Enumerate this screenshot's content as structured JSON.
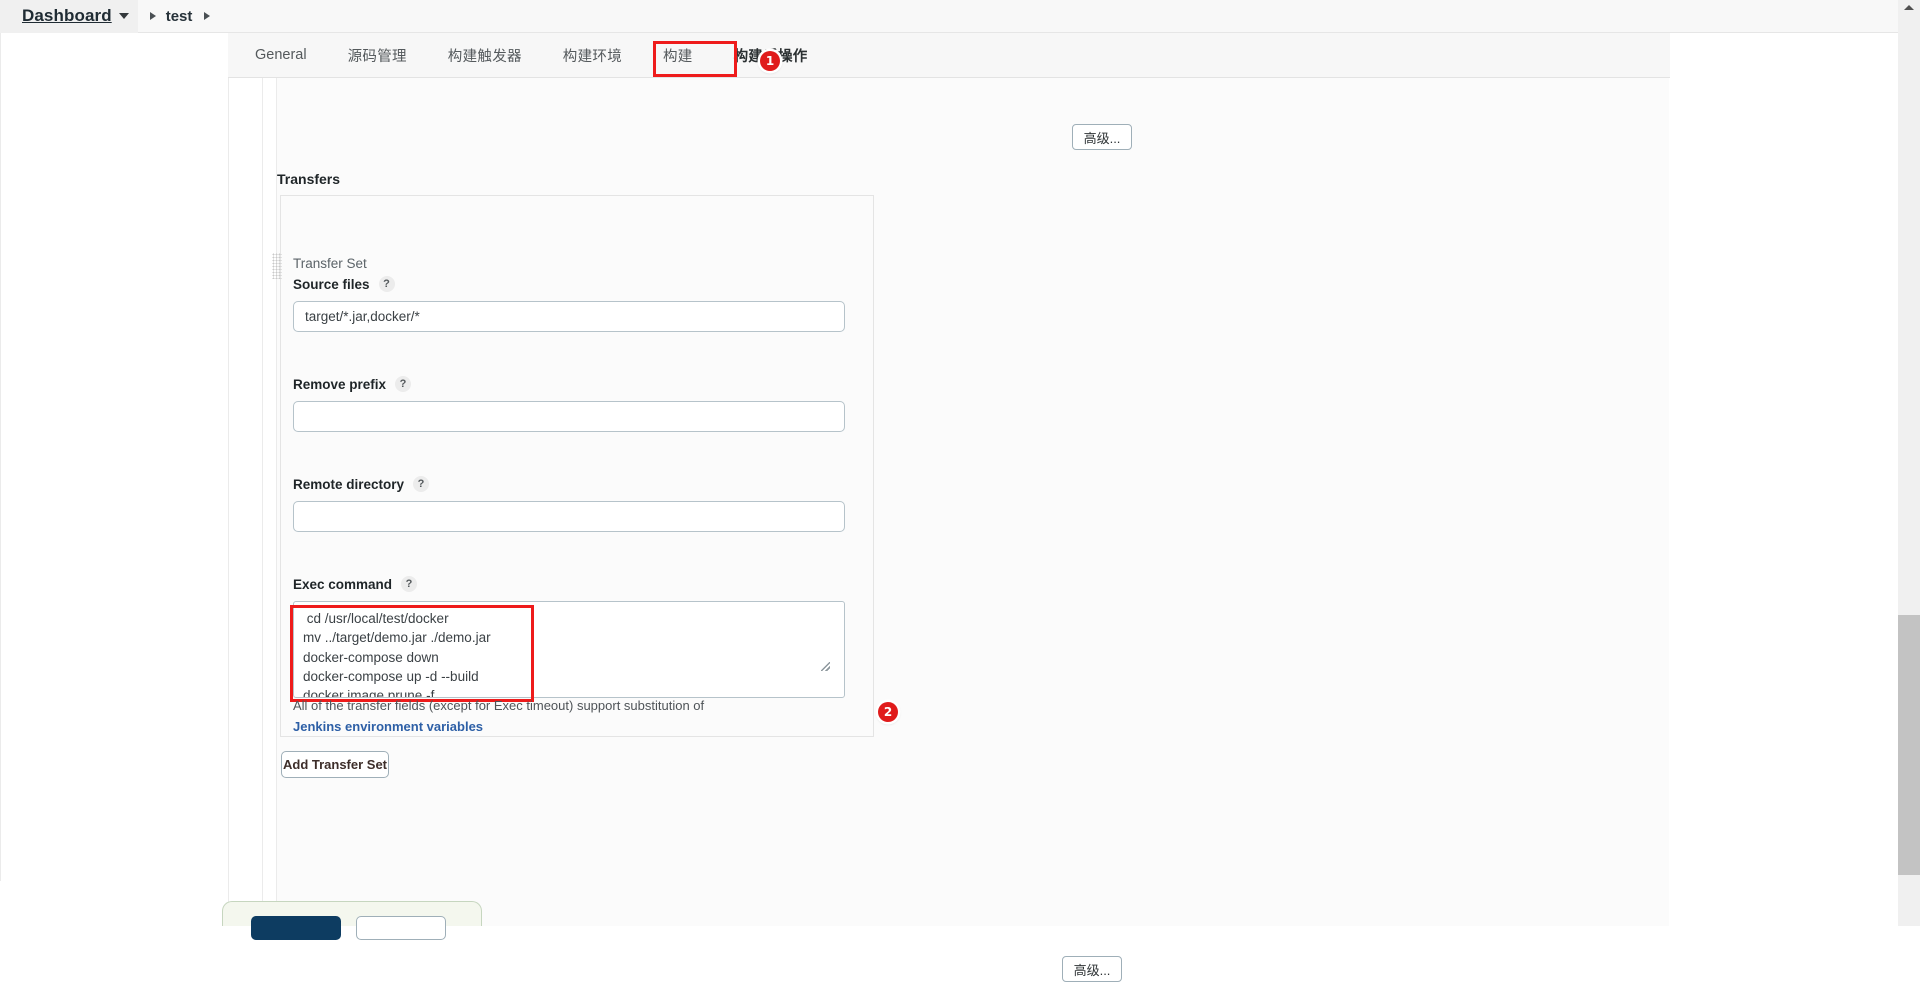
{
  "breadcrumb": {
    "dashboard_label": "Dashboard",
    "project_label": "test",
    "caret_icon": "chevron-down-icon",
    "separator_icon": "chevron-right-icon"
  },
  "tabs": [
    {
      "id": "general",
      "label": "General"
    },
    {
      "id": "source-control",
      "label": "源码管理"
    },
    {
      "id": "build-triggers",
      "label": "构建触发器"
    },
    {
      "id": "build-env",
      "label": "构建环境"
    },
    {
      "id": "build",
      "label": "构建"
    },
    {
      "id": "post-build",
      "label": "构建后操作"
    }
  ],
  "annotations": {
    "badge_one": "1",
    "badge_two": "2"
  },
  "form": {
    "advanced_top_label": "高级...",
    "advanced_bottom_label": "高级...",
    "transfers_title": "Transfers",
    "transfer_set_label": "Transfer Set",
    "help_icon_label": "?",
    "fields": [
      {
        "id": "source-files",
        "label": "Source files",
        "value": "target/*.jar,docker/*",
        "placeholder": ""
      },
      {
        "id": "remove-prefix",
        "label": "Remove prefix",
        "value": "",
        "placeholder": ""
      },
      {
        "id": "remote-directory",
        "label": "Remote directory",
        "value": "",
        "placeholder": ""
      }
    ],
    "exec_command": {
      "label": "Exec command",
      "value": " cd /usr/local/test/docker\nmv ../target/demo.jar ./demo.jar\ndocker-compose down\ndocker-compose up -d --build\ndocker image prune -f"
    },
    "hint": {
      "prefix": "All of the transfer fields (except for Exec timeout) support substitution of ",
      "link_text": "Jenkins environment variables"
    },
    "add_transfer_set_label": "Add Transfer Set"
  },
  "colors": {
    "annotation_red": "#ee1b1b",
    "badge_red": "#e01b1b",
    "link_blue": "#2d5fa6",
    "primary_button": "#0d3c61",
    "save_bar_bg": "#f4f7ee"
  }
}
